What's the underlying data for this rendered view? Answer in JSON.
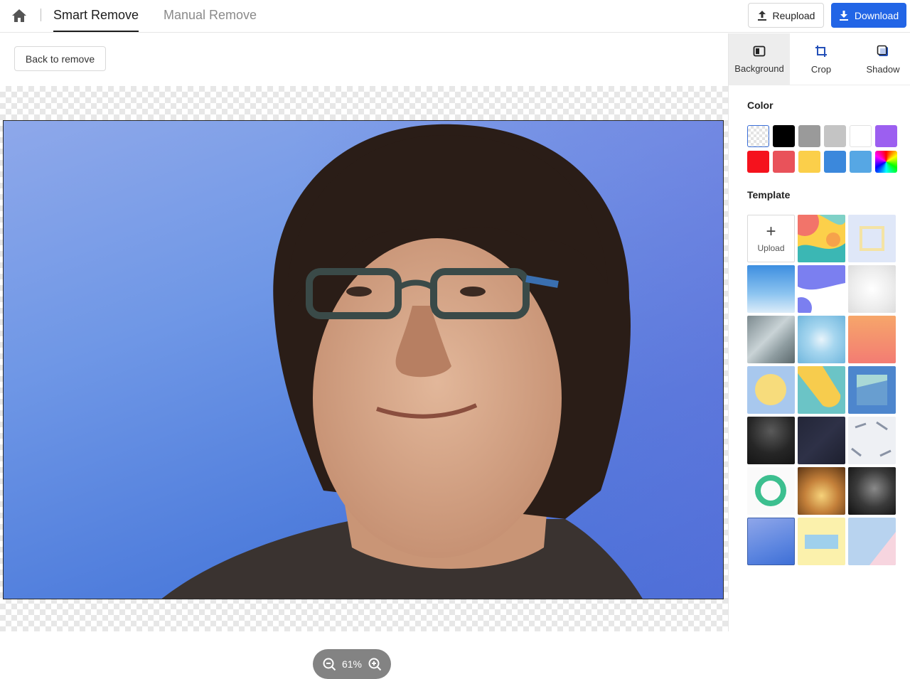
{
  "header": {
    "tabs": [
      {
        "label": "Smart Remove",
        "active": true
      },
      {
        "label": "Manual Remove",
        "active": false
      }
    ],
    "reupload_label": "Reupload",
    "download_label": "Download"
  },
  "workspace": {
    "back_label": "Back to remove",
    "zoom": "61%"
  },
  "panel": {
    "tabs": [
      {
        "label": "Background",
        "icon": "background-icon",
        "active": true
      },
      {
        "label": "Crop",
        "icon": "crop-icon",
        "active": false
      },
      {
        "label": "Shadow",
        "icon": "shadow-icon",
        "active": false
      }
    ],
    "color_title": "Color",
    "template_title": "Template",
    "upload_label": "Upload",
    "colors": [
      "transparent",
      "#000000",
      "#9a9a9a",
      "#c4c4c4",
      "#ffffff",
      "#9c5ff0",
      "#f5121d",
      "#e9525a",
      "#fbcf4a",
      "#3b88dc",
      "#56a7e4",
      "rainbow"
    ]
  },
  "colors": {
    "accent": "#2265e6",
    "canvas_bg_top": "#8ea8ea",
    "canvas_bg_bottom": "#3c6fd6"
  }
}
